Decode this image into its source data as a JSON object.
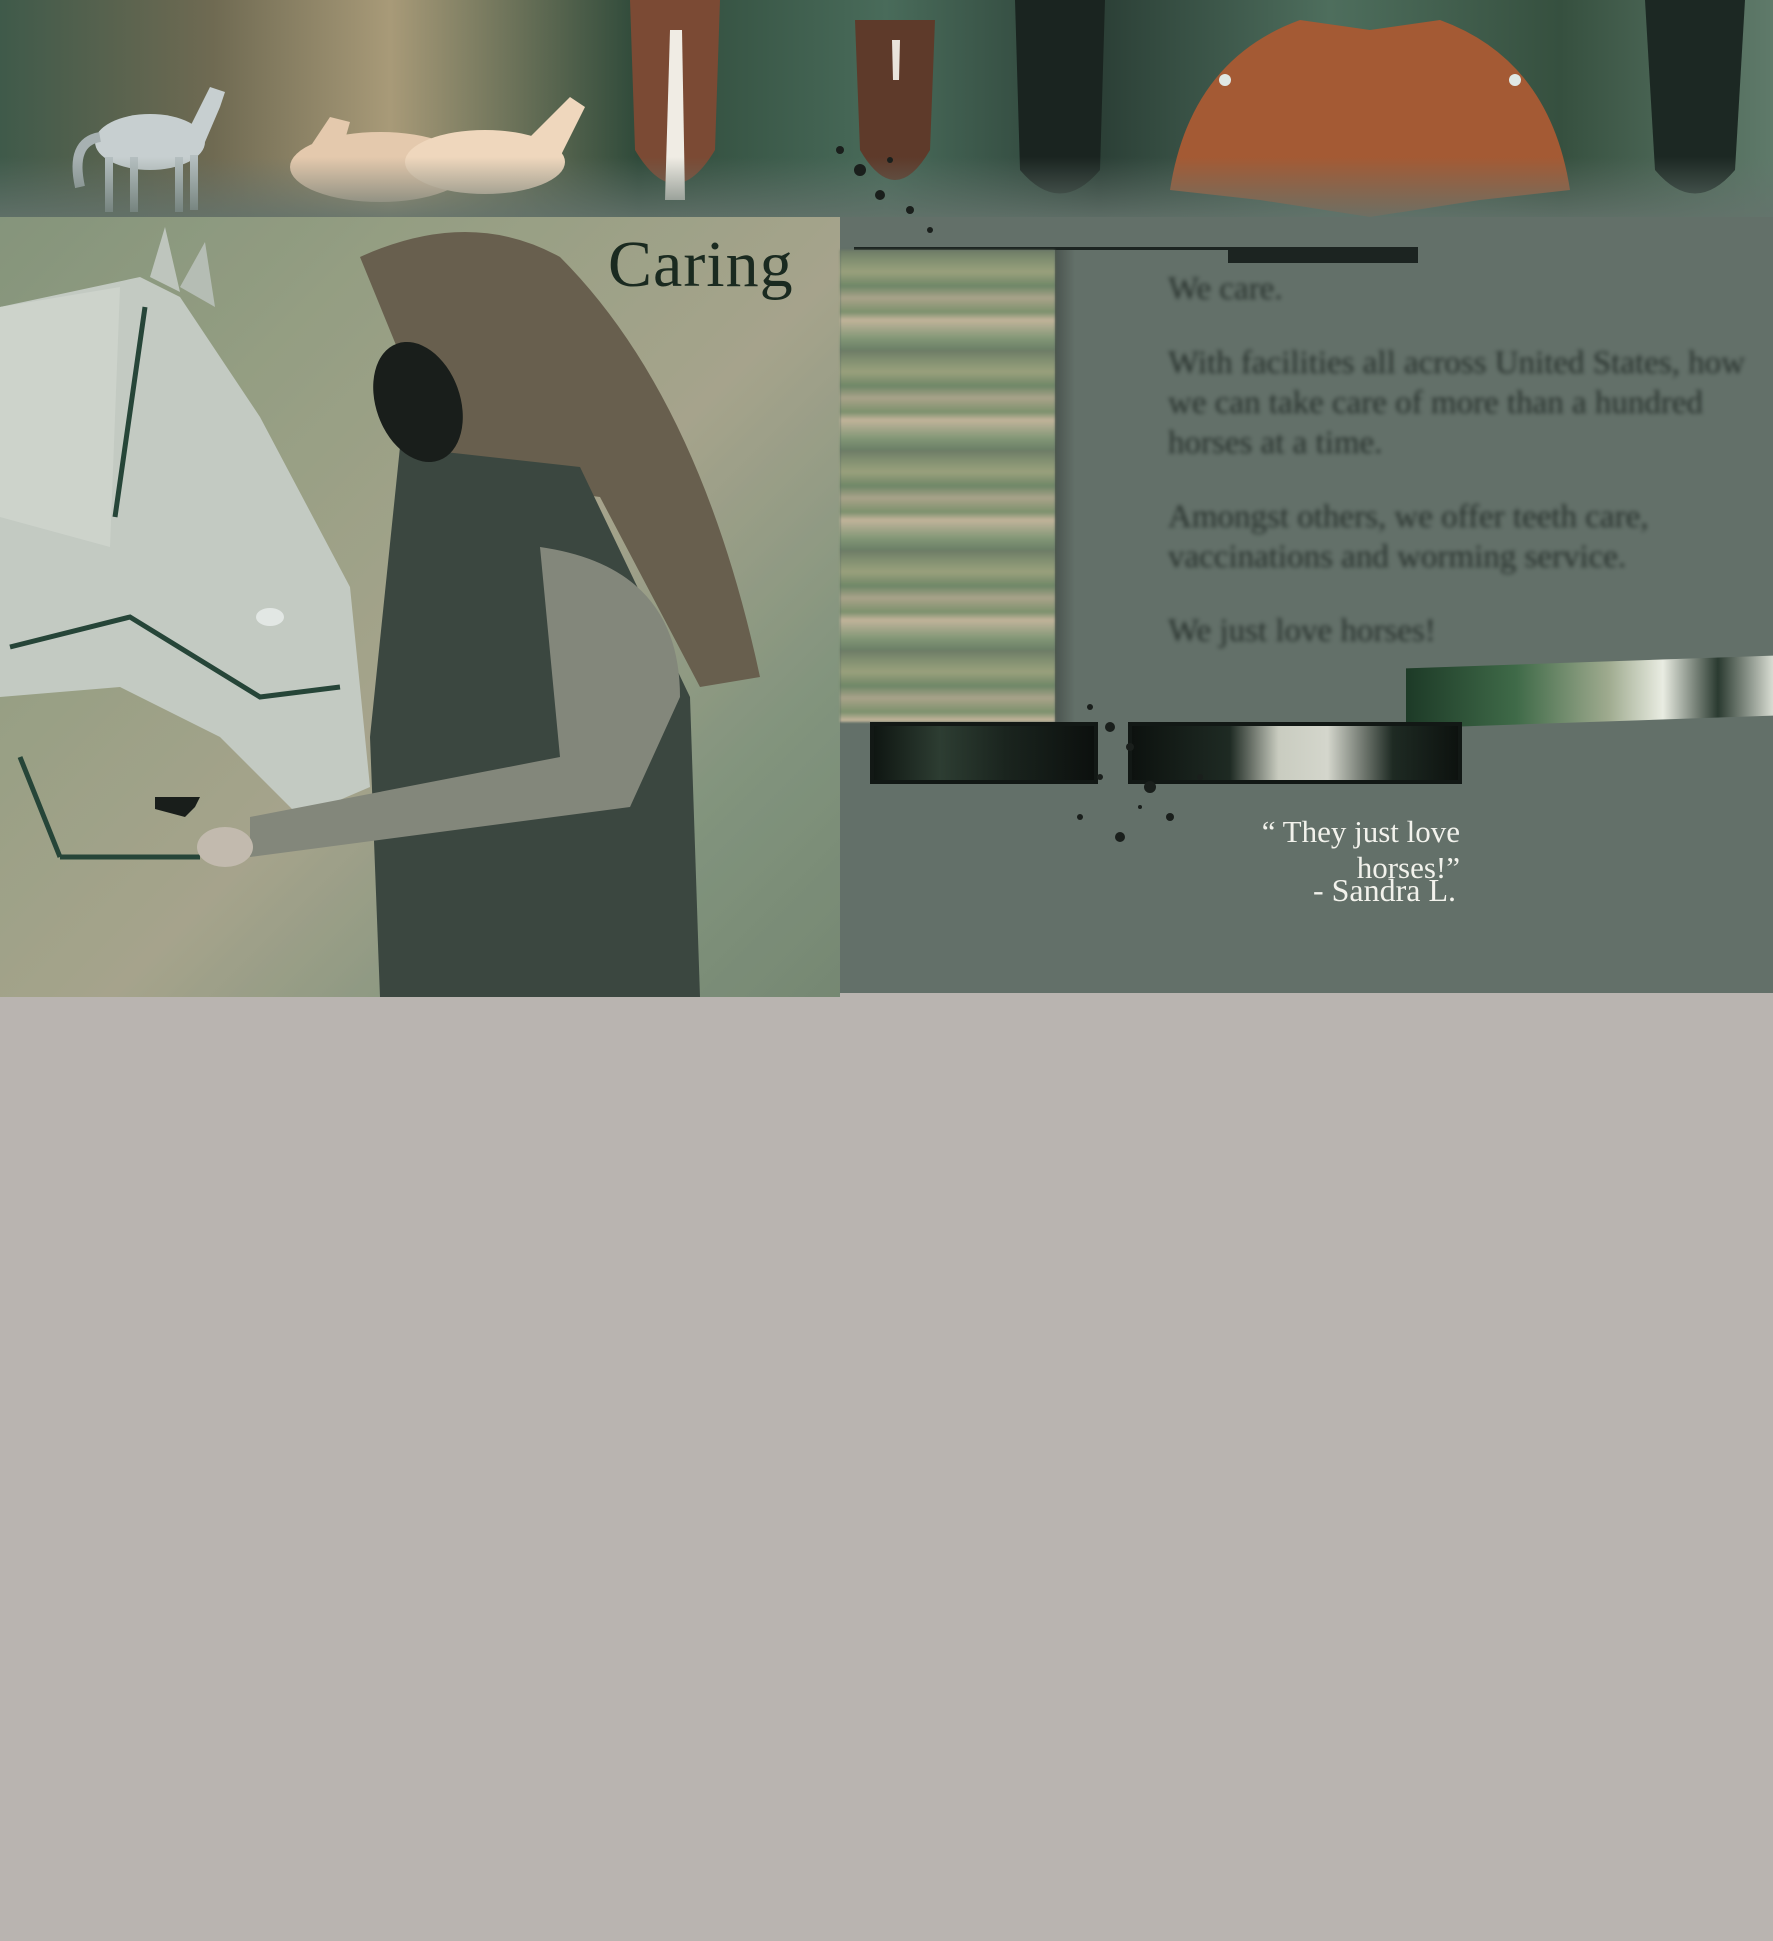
{
  "banner": {
    "image": "horses-banner"
  },
  "photo": {
    "title": "Caring",
    "image": "woman-with-white-horse-photo"
  },
  "content": {
    "paragraphs": [
      "We care.",
      "With facilities all across United States, how we can take care of more than a hundred horses at a time.",
      "Amongst others, we offer teeth care, vaccinations and worming service.",
      "We just love horses!"
    ]
  },
  "testimonial": {
    "quote": "“ They just love horses!”",
    "author": "- Sandra L."
  },
  "colors": {
    "panel": "#637069",
    "page_background": "#b9b4b0",
    "title": "#1a2a20",
    "quote_text": "#f2f2ec"
  }
}
